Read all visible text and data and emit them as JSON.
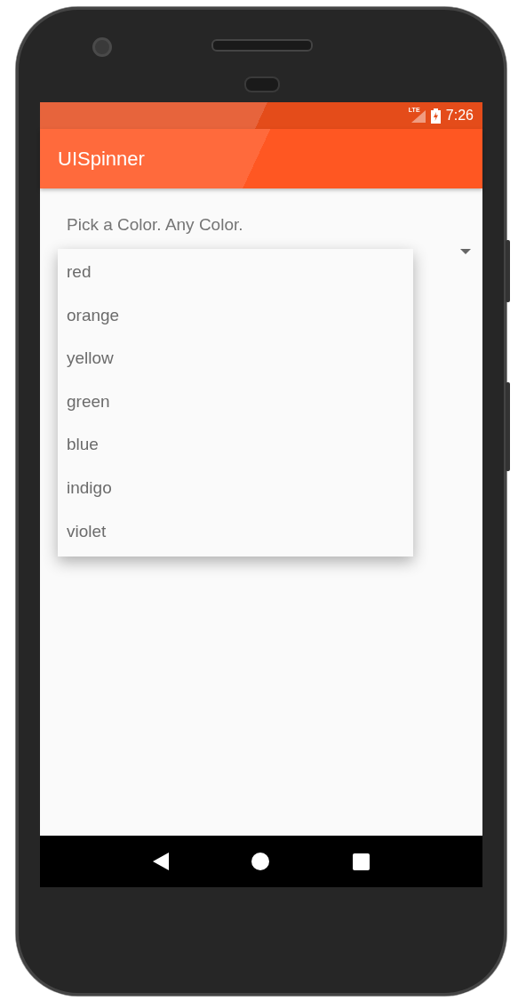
{
  "status_bar": {
    "network": "LTE",
    "time": "7:26"
  },
  "app_bar": {
    "title": "UISpinner"
  },
  "content": {
    "prompt": "Pick a Color. Any Color.",
    "spinner": {
      "expanded": true,
      "options": [
        {
          "label": "red"
        },
        {
          "label": "orange"
        },
        {
          "label": "yellow"
        },
        {
          "label": "green"
        },
        {
          "label": "blue"
        },
        {
          "label": "indigo"
        },
        {
          "label": "violet"
        }
      ]
    }
  }
}
